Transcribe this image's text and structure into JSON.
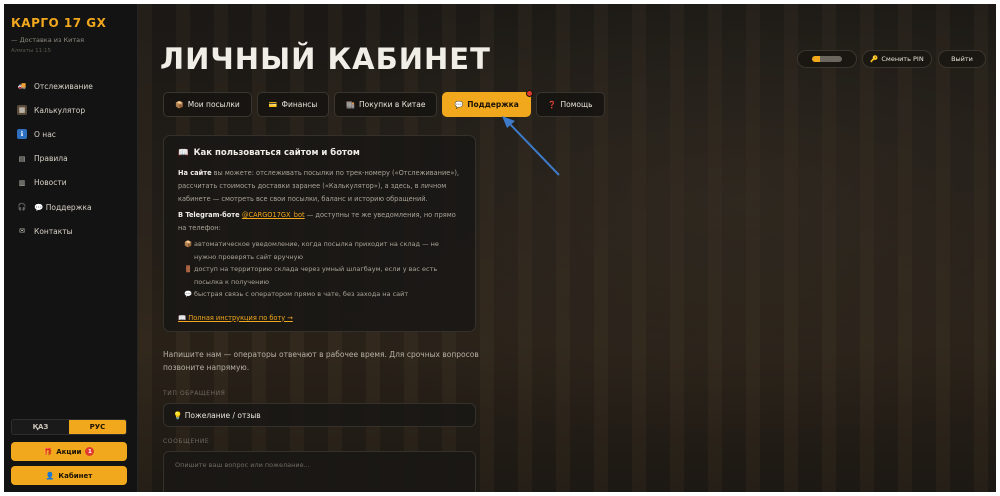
{
  "sidebar": {
    "brand": "КАРГО 17 GX",
    "subtitle": "— Доставка из Китая",
    "time": "Алматы 11:15",
    "items": [
      {
        "label": "Отслеживание",
        "icon": "truck-icon",
        "glyph": "🚚"
      },
      {
        "label": "Калькулятор",
        "icon": "calculator-icon",
        "glyph": "▦"
      },
      {
        "label": "О нас",
        "icon": "info-icon",
        "glyph": "ℹ"
      },
      {
        "label": "Правила",
        "icon": "document-icon",
        "glyph": "▤"
      },
      {
        "label": "Новости",
        "icon": "newspaper-icon",
        "glyph": "▥"
      },
      {
        "label": "💬 Поддержка",
        "icon": "headset-icon",
        "glyph": "🎧"
      },
      {
        "label": "Контакты",
        "icon": "mail-icon",
        "glyph": "✉"
      }
    ],
    "lang": {
      "kz": "ҚАЗ",
      "ru": "РУС"
    },
    "promo_label": "Акции",
    "promo_count": "1",
    "cabinet_label": "Кабинет"
  },
  "header": {
    "title": "ЛИЧНЫЙ КАБИНЕТ",
    "change_pin": "Сменить PIN",
    "logout": "Выйти"
  },
  "tabs": [
    {
      "label": "Мои посылки",
      "icon": "package-icon",
      "glyph": "📦"
    },
    {
      "label": "Финансы",
      "icon": "card-icon",
      "glyph": "💳"
    },
    {
      "label": "Покупки в Китае",
      "icon": "shop-icon",
      "glyph": "🏬"
    },
    {
      "label": "Поддержка",
      "icon": "chat-icon",
      "glyph": "💬"
    },
    {
      "label": "Помощь",
      "icon": "question-icon",
      "glyph": "❓"
    }
  ],
  "info": {
    "title": "Как пользоваться сайтом и ботом",
    "p1_bold": "На сайте",
    "p1_rest": " вы можете: отслеживать посылки по трек-номеру («Отслеживание»), рассчитать стоимость доставки заранее («Калькулятор»), а здесь, в личном кабинете — смотреть все свои посылки, баланс и историю обращений.",
    "p2_bold": "В Telegram-боте ",
    "p2_bot": "@CARGO17GX_bot",
    "p2_rest": " — доступны те же уведомления, но прямо на телефон:",
    "bullets": [
      {
        "glyph": "📦",
        "text": "автоматическое уведомление, когда посылка приходит на склад — не нужно проверять сайт вручную"
      },
      {
        "glyph": "🚪",
        "text": "доступ на территорию склада через умный шлагбаум, если у вас есть посылка к получению"
      },
      {
        "glyph": "💬",
        "text": "быстрая связь с оператором прямо в чате, без захода на сайт"
      }
    ],
    "link": "📖 Полная инструкция по боту →"
  },
  "support": {
    "intro": "Напишите нам — операторы отвечают в рабочее время. Для срочных вопросов позвоните напрямую.",
    "type_label": "ТИП ОБРАЩЕНИЯ",
    "type_value": "💡 Пожелание / отзыв",
    "message_label": "СООБЩЕНИЕ",
    "message_placeholder": "Опишите ваш вопрос или пожелание..."
  },
  "colors": {
    "accent": "#f2a81d",
    "badge": "#e03a2f",
    "arrow": "#3d7ac8"
  }
}
